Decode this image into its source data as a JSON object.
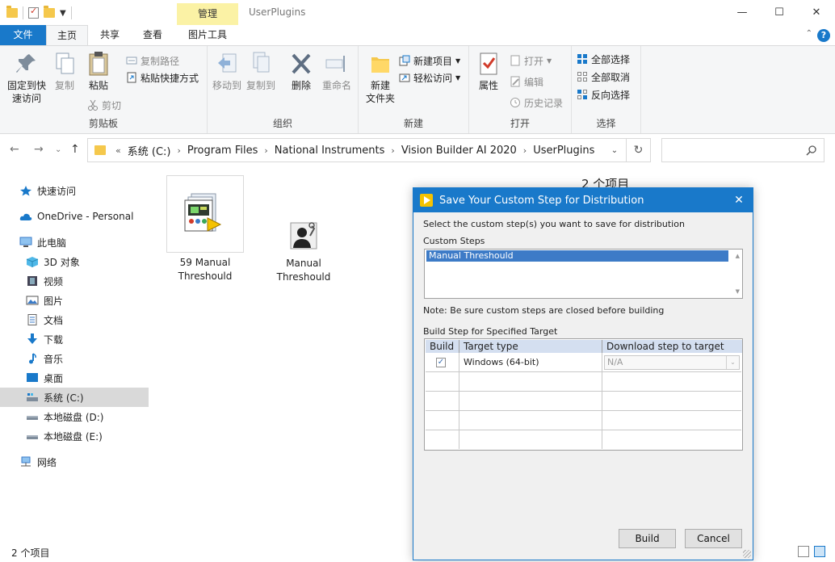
{
  "titlebar": {
    "context_tab_header": "管理",
    "window_title": "UserPlugins",
    "minimize": "—",
    "maximize": "☐",
    "close": "✕"
  },
  "ribbon_tabs": {
    "file": "文件",
    "home": "主页",
    "share": "共享",
    "view": "查看",
    "picture_tools": "图片工具"
  },
  "ribbon": {
    "clipboard": {
      "label": "剪贴板",
      "pin_line1": "固定到快",
      "pin_line2": "速访问",
      "copy": "复制",
      "paste": "粘贴",
      "copy_path": "复制路径",
      "paste_shortcut": "粘贴快捷方式",
      "cut": "剪切"
    },
    "organize": {
      "label": "组织",
      "move_to": "移动到",
      "copy_to": "复制到",
      "delete": "删除",
      "rename": "重命名"
    },
    "new": {
      "label": "新建",
      "new_folder_line1": "新建",
      "new_folder_line2": "文件夹",
      "new_item": "新建项目",
      "easy_access": "轻松访问"
    },
    "open": {
      "label": "打开",
      "properties": "属性",
      "open": "打开",
      "edit": "编辑",
      "history": "历史记录"
    },
    "select": {
      "label": "选择",
      "select_all": "全部选择",
      "select_none": "全部取消",
      "invert": "反向选择"
    }
  },
  "address": {
    "overflow": "«",
    "crumbs": [
      "系统 (C:)",
      "Program Files",
      "National Instruments",
      "Vision Builder AI 2020",
      "UserPlugins"
    ],
    "separator": "›"
  },
  "sidebar": {
    "items": [
      {
        "label": "快速访问",
        "icon": "star-icon"
      },
      {
        "label": "OneDrive - Personal",
        "icon": "cloud-icon"
      },
      {
        "label": "此电脑",
        "icon": "computer-icon"
      },
      {
        "label": "3D 对象",
        "icon": "cube-icon"
      },
      {
        "label": "视频",
        "icon": "film-icon"
      },
      {
        "label": "图片",
        "icon": "picture-icon"
      },
      {
        "label": "文档",
        "icon": "document-icon"
      },
      {
        "label": "下载",
        "icon": "download-icon"
      },
      {
        "label": "音乐",
        "icon": "music-icon"
      },
      {
        "label": "桌面",
        "icon": "desktop-icon"
      },
      {
        "label": "系统 (C:)",
        "icon": "drive-icon"
      },
      {
        "label": "本地磁盘 (D:)",
        "icon": "drive-icon"
      },
      {
        "label": "本地磁盘 (E:)",
        "icon": "drive-icon"
      },
      {
        "label": "网络",
        "icon": "network-icon"
      }
    ],
    "selected": "系统 (C:)"
  },
  "content": {
    "files": [
      {
        "line1": "59 Manual",
        "line2": "Threshould"
      },
      {
        "line1": "Manual",
        "line2": "Threshould"
      }
    ],
    "items_count_right": "2 个项目"
  },
  "statusbar": {
    "count": "2 个项目"
  },
  "dialog": {
    "title": "Save Your Custom Step for Distribution",
    "close": "✕",
    "instruction": "Select the custom step(s) you want to save for distribution",
    "custom_steps_label": "Custom Steps",
    "custom_steps": [
      "Manual Threshould"
    ],
    "note": "Note:  Be sure custom steps are closed before building",
    "build_target_label": "Build Step for Specified Target",
    "table": {
      "headers": [
        "Build",
        "Target type",
        "Download step to target"
      ],
      "rows": [
        {
          "build": "✓",
          "target_type": "Windows (64-bit)",
          "download": "N/A"
        }
      ]
    },
    "build_button": "Build",
    "cancel_button": "Cancel"
  },
  "colors": {
    "accent": "#1979ca",
    "context_tab": "#fbf2a5",
    "selection": "#3d7bc7"
  }
}
